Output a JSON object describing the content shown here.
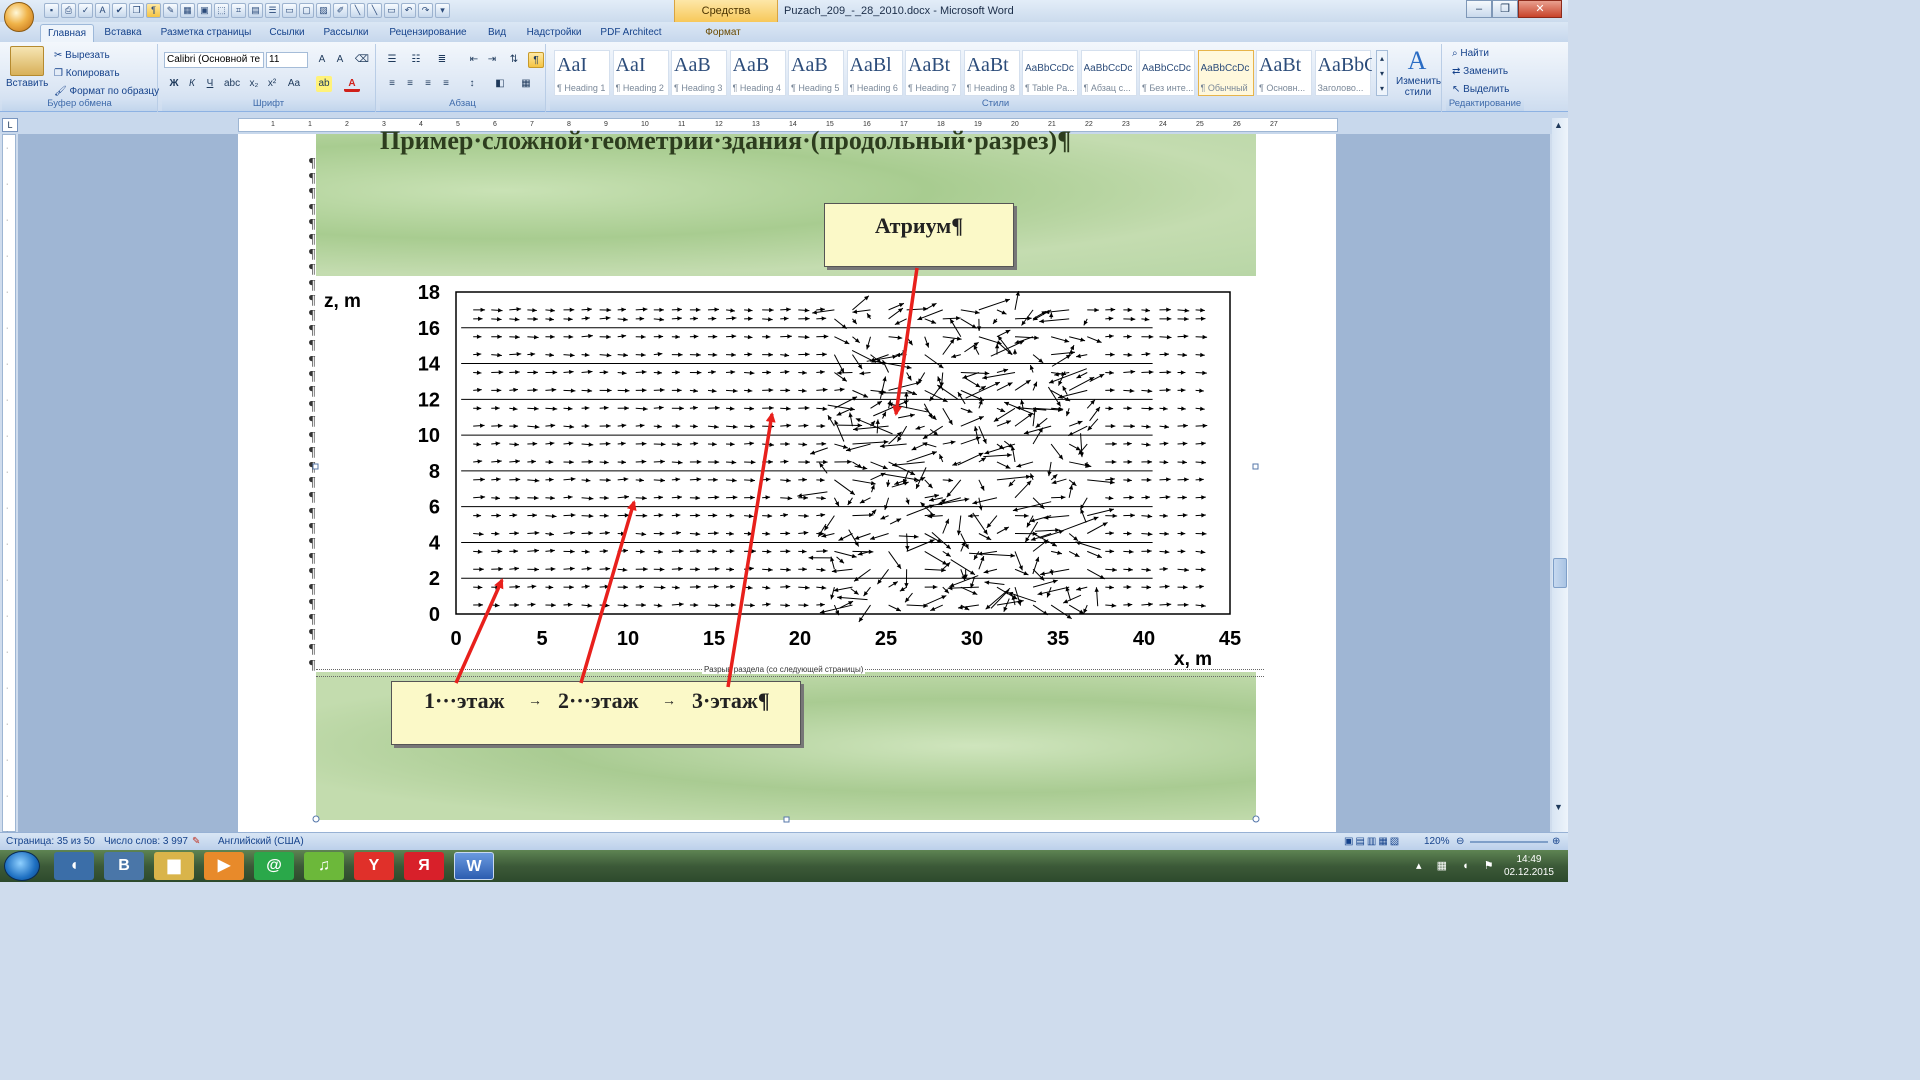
{
  "window": {
    "context_tab": "Средства рисования",
    "title": "Puzach_209_-_28_2010.docx - Microsoft Word"
  },
  "tabs": [
    "Главная",
    "Вставка",
    "Разметка страницы",
    "Ссылки",
    "Рассылки",
    "Рецензирование",
    "Вид",
    "Надстройки",
    "PDF Architect",
    "Формат"
  ],
  "ribbon": {
    "clipboard": {
      "paste": "Вставить",
      "cut": "Вырезать",
      "copy": "Копировать",
      "format_painter": "Формат по образцу",
      "label": "Буфер обмена"
    },
    "font": {
      "family": "Calibri (Основной те",
      "size": "11",
      "label": "Шрифт"
    },
    "paragraph": {
      "label": "Абзац"
    },
    "styles": {
      "label": "Стили",
      "change_styles": "Изменить стили",
      "items": [
        {
          "preview": "AaI",
          "caption": "¶ Heading 1"
        },
        {
          "preview": "AaI",
          "caption": "¶ Heading 2"
        },
        {
          "preview": "AaB",
          "caption": "¶ Heading 3"
        },
        {
          "preview": "AaB",
          "caption": "¶ Heading 4"
        },
        {
          "preview": "AaB",
          "caption": "¶ Heading 5"
        },
        {
          "preview": "AaBl",
          "caption": "¶ Heading 6"
        },
        {
          "preview": "AaBt",
          "caption": "¶ Heading 7"
        },
        {
          "preview": "AaBt",
          "caption": "¶ Heading 8"
        },
        {
          "preview": "AaBbCcDc",
          "caption": "¶ Table Pa..."
        },
        {
          "preview": "AaBbCcDc",
          "caption": "¶ Абзац с..."
        },
        {
          "preview": "AaBbCcDc",
          "caption": "¶ Без инте..."
        },
        {
          "preview": "AaBbCcDc",
          "caption": "¶ Обычный"
        },
        {
          "preview": "AaBt",
          "caption": "¶ Основн..."
        },
        {
          "preview": "AaBbC",
          "caption": "Заголово..."
        }
      ]
    },
    "editing": {
      "find": "Найти",
      "replace": "Заменить",
      "select": "Выделить",
      "label": "Редактирование"
    }
  },
  "ruler_ticks": [
    "1",
    "1",
    "2",
    "3",
    "4",
    "5",
    "6",
    "7",
    "8",
    "9",
    "10",
    "11",
    "12",
    "13",
    "14",
    "15",
    "16",
    "17",
    "18",
    "19",
    "20",
    "21",
    "22",
    "23",
    "24",
    "25",
    "26",
    "27"
  ],
  "document": {
    "heading": "Пример·сложной·геометрии·здания·(продольный·разрез)¶",
    "atrium_label": "Атриум¶",
    "floor1": "1···этаж",
    "floor2": "2···этаж",
    "floor3": "3·этаж¶",
    "arrow_sep": "→",
    "section_break": "Разрыв раздела (со следующей страницы)",
    "para_mark": "¶"
  },
  "chart_data": {
    "type": "quiver",
    "xlabel": "x, m",
    "ylabel": "z, m",
    "xlim": [
      0,
      45
    ],
    "ylim": [
      0,
      18
    ],
    "xticks": [
      0,
      5,
      10,
      15,
      20,
      25,
      30,
      35,
      40,
      45
    ],
    "yticks": [
      0,
      2,
      4,
      6,
      8,
      10,
      12,
      14,
      16,
      18
    ],
    "floor_levels_z": [
      0,
      2,
      4,
      6,
      8,
      10,
      12,
      14,
      16
    ]
  },
  "status": {
    "page": "Страница: 35 из 50",
    "words": "Число слов: 3 997",
    "language": "Английский (США)",
    "zoom": "120%"
  },
  "taskbar": {
    "time": "14:49",
    "date": "02.12.2015"
  },
  "colors": {
    "arrow_red": "#e8201c",
    "callout_fill": "#fbf9c8"
  }
}
